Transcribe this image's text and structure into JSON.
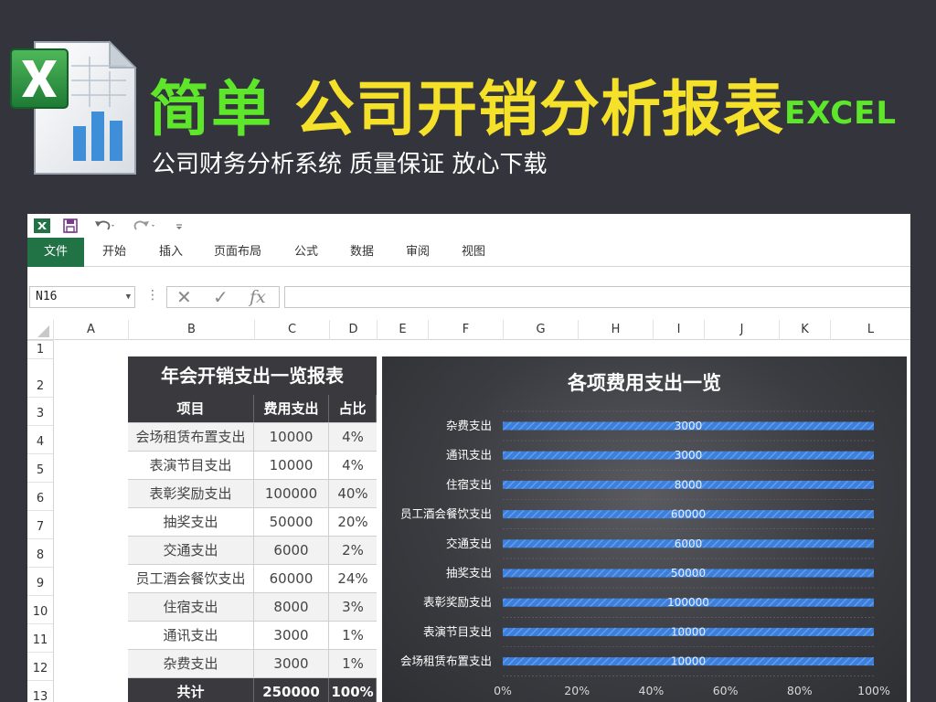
{
  "banner": {
    "title_green": "简单",
    "title_yellow": "公司开销分析报表",
    "title_excel": "EXCEL",
    "subtitle": "公司财务分析系统 质量保证 放心下载"
  },
  "ribbon": {
    "tabs": [
      "文件",
      "开始",
      "插入",
      "页面布局",
      "公式",
      "数据",
      "审阅",
      "视图"
    ]
  },
  "formula_bar": {
    "name_box": "N16",
    "fx_label": "fx",
    "formula": ""
  },
  "grid": {
    "columns": [
      "A",
      "B",
      "C",
      "D",
      "E",
      "F",
      "G",
      "H",
      "I",
      "J",
      "K",
      "L"
    ],
    "rows": [
      "1",
      "2",
      "3",
      "4",
      "5",
      "6",
      "7",
      "8",
      "9",
      "10",
      "11",
      "12",
      "13"
    ]
  },
  "table": {
    "title": "年会开销支出一览报表",
    "headers": [
      "项目",
      "费用支出",
      "占比"
    ],
    "rows": [
      [
        "会场租赁布置支出",
        "10000",
        "4%"
      ],
      [
        "表演节目支出",
        "10000",
        "4%"
      ],
      [
        "表彰奖励支出",
        "100000",
        "40%"
      ],
      [
        "抽奖支出",
        "50000",
        "20%"
      ],
      [
        "交通支出",
        "6000",
        "2%"
      ],
      [
        "员工酒会餐饮支出",
        "60000",
        "24%"
      ],
      [
        "住宿支出",
        "8000",
        "3%"
      ],
      [
        "通讯支出",
        "3000",
        "1%"
      ],
      [
        "杂费支出",
        "3000",
        "1%"
      ]
    ],
    "total": [
      "共计",
      "250000",
      "100%"
    ]
  },
  "colors": {
    "banner_bg": "#34353c",
    "title_green": "#5ee62a",
    "title_yellow": "#f5e12a",
    "excel_green": "#217346",
    "bar_blue": "#3d7fdc"
  },
  "chart_data": {
    "type": "bar",
    "orientation": "horizontal",
    "stacked_percent": true,
    "title": "各项费用支出一览",
    "categories": [
      "杂费支出",
      "通讯支出",
      "住宿支出",
      "员工酒会餐饮支出",
      "交通支出",
      "抽奖支出",
      "表彰奖励支出",
      "表演节目支出",
      "会场租赁布置支出"
    ],
    "values": [
      3000,
      3000,
      8000,
      60000,
      6000,
      50000,
      100000,
      10000,
      10000
    ],
    "data_labels": [
      "3000",
      "3000",
      "8000",
      "60000",
      "6000",
      "50000",
      "100000",
      "10000",
      "10000"
    ],
    "x_ticks": [
      "0%",
      "20%",
      "40%",
      "60%",
      "80%",
      "100%"
    ],
    "xlim": [
      0,
      100
    ],
    "grid": true,
    "legend": "none"
  }
}
